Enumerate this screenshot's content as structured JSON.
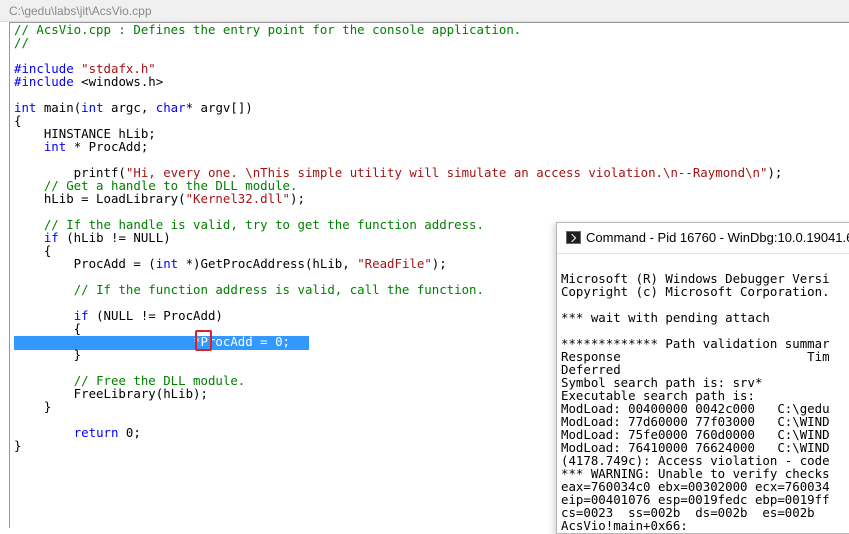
{
  "window": {
    "title": "C:\\gedu\\labs\\jit\\AcsVio.cpp"
  },
  "code_lines": [
    [
      {
        "t": "// AcsVio.cpp : Defines the entry point for the console application.",
        "c": "comment"
      }
    ],
    [
      {
        "t": "//",
        "c": "comment"
      }
    ],
    [
      {
        "t": "",
        "c": "plain"
      }
    ],
    [
      {
        "t": "#include ",
        "c": "preproc"
      },
      {
        "t": "\"stdafx.h\"",
        "c": "string"
      }
    ],
    [
      {
        "t": "#include ",
        "c": "preproc"
      },
      {
        "t": "<windows.h>",
        "c": "plain"
      }
    ],
    [
      {
        "t": "",
        "c": "plain"
      }
    ],
    [
      {
        "t": "int",
        "c": "keyword"
      },
      {
        "t": " main(",
        "c": "plain"
      },
      {
        "t": "int",
        "c": "keyword"
      },
      {
        "t": " argc, ",
        "c": "plain"
      },
      {
        "t": "char",
        "c": "keyword"
      },
      {
        "t": "* argv[])",
        "c": "plain"
      }
    ],
    [
      {
        "t": "{",
        "c": "plain"
      }
    ],
    [
      {
        "t": "    HINSTANCE hLib;",
        "c": "plain"
      }
    ],
    [
      {
        "t": "    ",
        "c": "plain"
      },
      {
        "t": "int",
        "c": "keyword"
      },
      {
        "t": " * ProcAdd;",
        "c": "plain"
      }
    ],
    [
      {
        "t": "",
        "c": "plain"
      }
    ],
    [
      {
        "t": "        printf(",
        "c": "plain"
      },
      {
        "t": "\"Hi, every one. \\nThis simple utility will simulate an access violation.\\n--Raymond\\n\"",
        "c": "string"
      },
      {
        "t": ");",
        "c": "plain"
      }
    ],
    [
      {
        "t": "    ",
        "c": "plain"
      },
      {
        "t": "// Get a handle to the DLL module.",
        "c": "comment"
      }
    ],
    [
      {
        "t": "    hLib = LoadLibrary(",
        "c": "plain"
      },
      {
        "t": "\"Kernel32.dll\"",
        "c": "string"
      },
      {
        "t": ");",
        "c": "plain"
      }
    ],
    [
      {
        "t": "",
        "c": "plain"
      }
    ],
    [
      {
        "t": "    ",
        "c": "plain"
      },
      {
        "t": "// If the handle is valid, try to get the function address.",
        "c": "comment"
      }
    ],
    [
      {
        "t": "    ",
        "c": "plain"
      },
      {
        "t": "if",
        "c": "keyword"
      },
      {
        "t": " (hLib != NULL)",
        "c": "plain"
      }
    ],
    [
      {
        "t": "    {",
        "c": "plain"
      }
    ],
    [
      {
        "t": "        ProcAdd = (",
        "c": "plain"
      },
      {
        "t": "int",
        "c": "keyword"
      },
      {
        "t": " *)GetProcAddress(hLib, ",
        "c": "plain"
      },
      {
        "t": "\"ReadFile\"",
        "c": "string"
      },
      {
        "t": ");",
        "c": "plain"
      }
    ],
    [
      {
        "t": "",
        "c": "plain"
      }
    ],
    [
      {
        "t": "        ",
        "c": "plain"
      },
      {
        "t": "// If the function address is valid, call the function.",
        "c": "comment"
      }
    ],
    [
      {
        "t": "",
        "c": "plain"
      }
    ],
    [
      {
        "t": "        ",
        "c": "plain"
      },
      {
        "t": "if",
        "c": "keyword"
      },
      {
        "t": " (NULL != ProcAdd)",
        "c": "plain"
      }
    ],
    [
      {
        "t": "        {",
        "c": "plain"
      }
    ],
    [
      {
        "t": "                        *ProcAdd = 0;",
        "c": "sel"
      }
    ],
    [
      {
        "t": "        }",
        "c": "plain"
      }
    ],
    [
      {
        "t": "",
        "c": "plain"
      }
    ],
    [
      {
        "t": "        ",
        "c": "plain"
      },
      {
        "t": "// Free the DLL module.",
        "c": "comment"
      }
    ],
    [
      {
        "t": "        FreeLibrary(hLib);",
        "c": "plain"
      }
    ],
    [
      {
        "t": "    }",
        "c": "plain"
      }
    ],
    [
      {
        "t": "",
        "c": "plain"
      }
    ],
    [
      {
        "t": "        ",
        "c": "plain"
      },
      {
        "t": "return",
        "c": "keyword"
      },
      {
        "t": " 0;",
        "c": "plain"
      }
    ],
    [
      {
        "t": "}",
        "c": "plain"
      }
    ]
  ],
  "command_window": {
    "title": "Command - Pid 16760 - WinDbg:10.0.19041.6",
    "lines": [
      "",
      "Microsoft (R) Windows Debugger Versi",
      "Copyright (c) Microsoft Corporation.",
      "",
      "*** wait with pending attach",
      "",
      "************* Path validation summar",
      "Response                         Tim",
      "Deferred",
      "Symbol search path is: srv*",
      "Executable search path is:",
      "ModLoad: 00400000 0042c000   C:\\gedu",
      "ModLoad: 77d60000 77f03000   C:\\WIND",
      "ModLoad: 75fe0000 760d0000   C:\\WIND",
      "ModLoad: 76410000 76624000   C:\\WIND",
      "(4178.749c): Access violation - code",
      "*** WARNING: Unable to verify checks",
      "eax=760034c0 ebx=00302000 ecx=760034",
      "eip=00401076 esp=0019fedc ebp=0019ff",
      "cs=0023  ss=002b  ds=002b  es=002b",
      "AcsVio!main+0x66:"
    ]
  }
}
